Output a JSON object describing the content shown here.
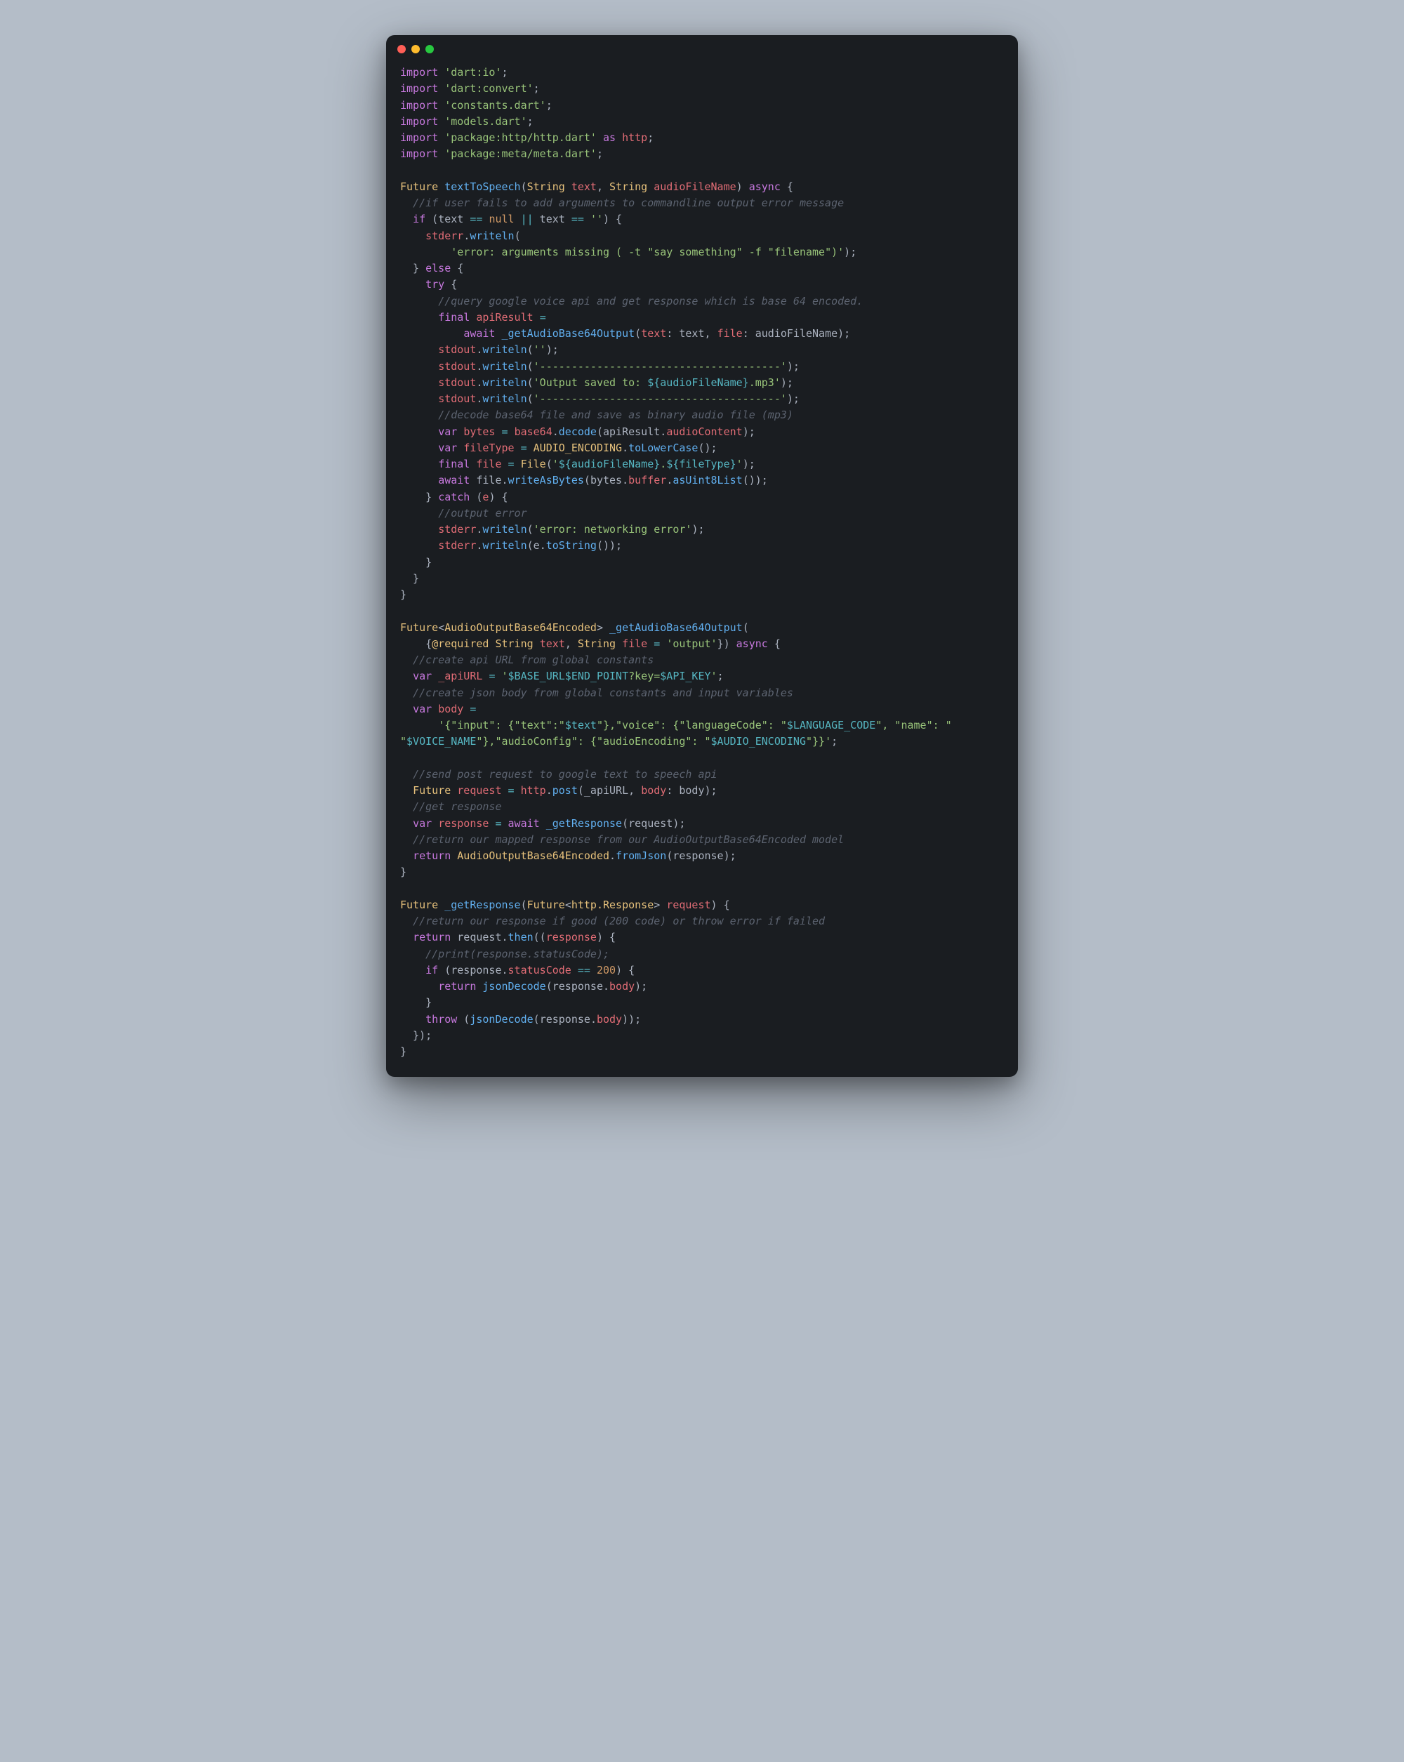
{
  "window": {
    "traffic_lights": [
      "close",
      "minimize",
      "maximize"
    ]
  },
  "code": {
    "imports": [
      {
        "kw": "import",
        "lit": "'dart:io'"
      },
      {
        "kw": "import",
        "lit": "'dart:convert'"
      },
      {
        "kw": "import",
        "lit": "'constants.dart'"
      },
      {
        "kw": "import",
        "lit": "'models.dart'"
      },
      {
        "kw": "import",
        "lit": "'package:http/http.dart'",
        "as_kw": "as",
        "alias": "http"
      },
      {
        "kw": "import",
        "lit": "'package:meta/meta.dart'"
      }
    ],
    "fn1": {
      "ret": "Future",
      "name": "textToSpeech",
      "param1_type": "String",
      "param1_name": "text",
      "param2_type": "String",
      "param2_name": "audioFileName",
      "async": "async",
      "c1": "//if user fails to add arguments to commandline output error message",
      "if_kw": "if",
      "cond_l": "(text ",
      "eq1": "==",
      "null_kw": "null",
      "or": "||",
      "cond_r": " text ",
      "eq2": "==",
      "empty": "''",
      "stderr1a": "stderr",
      "stderr1b": "writeln",
      "err_msg": "'error: arguments missing ( -t \"say something\" -f \"filename\")'",
      "else_kw": "else",
      "try_kw": "try",
      "c2": "//query google voice api and get response which is base 64 encoded.",
      "final1": "final",
      "apiResult": "apiResult",
      "await1": "await",
      "getAudio": "_getAudioBase64Output",
      "p_text": "text",
      "p_file": "file",
      "arg_text": "text",
      "arg_file": "audioFileName",
      "stdout": "stdout",
      "writeln": "writeln",
      "s_empty": "''",
      "s_dash": "'--------------------------------------'",
      "s_out_a": "'Output saved to: ",
      "s_out_b": "${audioFileName}",
      "s_out_c": ".mp3'",
      "c3": "//decode base64 file and save as binary audio file (mp3)",
      "var1": "var",
      "bytes": "bytes",
      "base64": "base64",
      "decode": "decode",
      "audioContent": "audioContent",
      "var2": "var",
      "fileType": "fileType",
      "AUDIO_ENCODING": "AUDIO_ENCODING",
      "toLowerCase": "toLowerCase",
      "final2": "final",
      "file_var": "file",
      "File": "File",
      "file_str_a": "'",
      "file_str_b": "${audioFileName}",
      "file_str_c": ".",
      "file_str_d": "${fileType}",
      "file_str_e": "'",
      "await2": "await",
      "writeAsBytes": "writeAsBytes",
      "buffer": "buffer",
      "asUint8List": "asUint8List",
      "catch_kw": "catch",
      "catch_e": "e",
      "c4": "//output error",
      "err2": "'error: networking error'",
      "toString": "toString"
    },
    "fn2": {
      "ret": "Future",
      "gen": "AudioOutputBase64Encoded",
      "name": "_getAudioBase64Output",
      "required": "@required",
      "String": "String",
      "p_text": "text",
      "p_file": "file",
      "def_file": "'output'",
      "async": "async",
      "c1": "//create api URL from global constants",
      "var1": "var",
      "apiURL": "_apiURL",
      "url_a": "'",
      "url_b": "$BASE_URL$END_POINT",
      "url_c": "?key=",
      "url_d": "$API_KEY",
      "url_e": "'",
      "c2": "//create json body from global constants and input variables",
      "var2": "var",
      "body": "body",
      "body_a": "'{\"input\": {\"text\":\"",
      "body_b": "$text",
      "body_c": "\"},\"voice\": {\"languageCode\": \"",
      "body_d": "$LANGUAGE_CODE",
      "body_e": "\", \"name\": \"",
      "body_f": "$VOICE_NAME",
      "body_g": "\"},\"audioConfig\": {\"audioEncoding\": \"",
      "body_h": "$AUDIO_ENCODING",
      "body_i": "\"}}'",
      "c3": "//send post request to google text to speech api",
      "Future": "Future",
      "request": "request",
      "http": "http",
      "post": "post",
      "p_body": "body",
      "c4": "//get response",
      "var3": "var",
      "response": "response",
      "await": "await",
      "getResponse": "_getResponse",
      "c5": "//return our mapped response from our AudioOutputBase64Encoded model",
      "return": "return",
      "AOB64": "AudioOutputBase64Encoded",
      "fromJson": "fromJson"
    },
    "fn3": {
      "ret": "Future",
      "name": "_getResponse",
      "Future": "Future",
      "httpResp": "http.Response",
      "request": "request",
      "c1": "//return our response if good (200 code) or throw error if failed",
      "return1": "return",
      "then": "then",
      "response": "response",
      "c2": "//print(response.statusCode);",
      "if_kw": "if",
      "statusCode": "statusCode",
      "eq": "==",
      "code200": "200",
      "return2": "return",
      "jsonDecode": "jsonDecode",
      "body": "body",
      "throw": "throw"
    }
  }
}
